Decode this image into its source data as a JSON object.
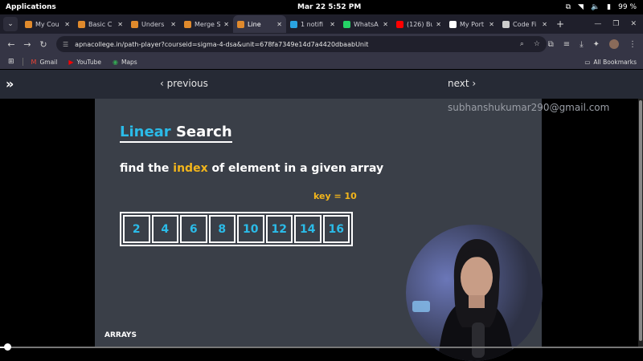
{
  "system": {
    "apps_label": "Applications",
    "clock": "Mar 22  5:52 PM",
    "battery": "99 %"
  },
  "tabs": [
    {
      "title": "My Cou",
      "color": "#e08a2c",
      "active": false
    },
    {
      "title": "Basic C",
      "color": "#e08a2c",
      "active": false
    },
    {
      "title": "Unders",
      "color": "#e08a2c",
      "active": false
    },
    {
      "title": "Merge S",
      "color": "#e08a2c",
      "active": false
    },
    {
      "title": "Line",
      "color": "#e08a2c",
      "active": true
    },
    {
      "title": "1 notifi",
      "color": "#2aa3e0",
      "active": false
    },
    {
      "title": "WhatsA",
      "color": "#25d366",
      "active": false
    },
    {
      "title": "(126) Bu",
      "color": "#ff0000",
      "active": false
    },
    {
      "title": "My Port",
      "color": "#ffffff",
      "active": false
    },
    {
      "title": "Code Fi",
      "color": "#cccccc",
      "active": false
    }
  ],
  "address": {
    "url": "apnacollege.in/path-player?courseid=sigma-4-dsa&unit=678fa7349e14d7a4420dbaabUnit"
  },
  "bookmarks": {
    "items": [
      {
        "label": "Gmail",
        "icon": "gmail-icon"
      },
      {
        "label": "YouTube",
        "icon": "youtube-icon"
      },
      {
        "label": "Maps",
        "icon": "maps-icon"
      }
    ],
    "all_label": "All Bookmarks"
  },
  "player": {
    "prev_label": "‹ previous",
    "next_label": "next ›",
    "progress_fraction": 0.01
  },
  "slide": {
    "title_highlight": "Linear",
    "title_rest": " Search",
    "subtitle_a": "find the ",
    "subtitle_idx": "index",
    "subtitle_b": " of element in a given array",
    "key": "key = 10",
    "array": [
      "2",
      "4",
      "6",
      "8",
      "10",
      "12",
      "14",
      "16"
    ],
    "section_label": "ARRAYS"
  },
  "watermark": "subhanshukumar290@gmail.com"
}
